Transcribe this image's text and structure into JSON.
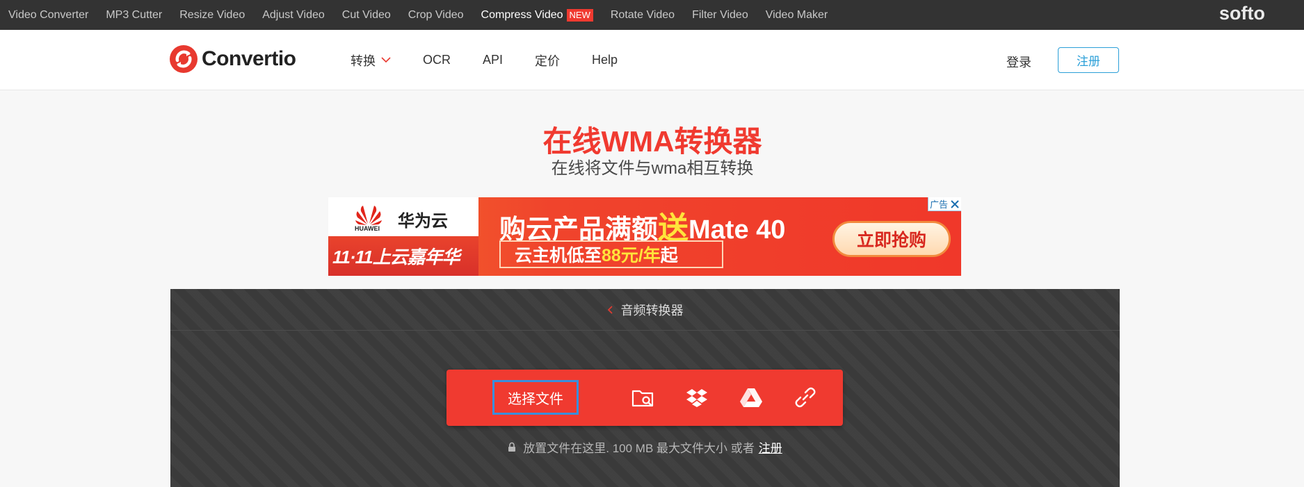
{
  "topbar": {
    "links": [
      "Video Converter",
      "MP3 Cutter",
      "Resize Video",
      "Adjust Video",
      "Cut Video",
      "Crop Video",
      "Compress Video",
      "Rotate Video",
      "Filter Video",
      "Video Maker"
    ],
    "new_badge": "NEW",
    "brand": "softo"
  },
  "header": {
    "logo_text": "Convertio",
    "nav": [
      "转换",
      "OCR",
      "API",
      "定价",
      "Help"
    ],
    "login": "登录",
    "register": "注册"
  },
  "hero": {
    "title": "在线WMA转换器",
    "subtitle": "在线将文件与wma相互转换"
  },
  "ad": {
    "brand_en": "HUAWEI",
    "brand_cn": "华为云",
    "promo_left": "11·11上云嘉年华",
    "headline_pre": "购云产品满额",
    "headline_song": "送",
    "headline_post": "Mate 40",
    "sub_pre": "云主机低至",
    "sub_hl": "88元/年",
    "sub_post": "起",
    "cta": "立即抢购",
    "tag": "广告"
  },
  "converter": {
    "breadcrumb": "音频转换器",
    "choose_files": "选择文件",
    "hint": "放置文件在这里. 100 MB 最大文件大小 或者",
    "hint_link": "注册"
  },
  "colors": {
    "accent_red": "#f03a30",
    "link_blue": "#2a9fd8",
    "topbar_bg": "#333333"
  },
  "icons": [
    "folder-search-icon",
    "dropbox-icon",
    "google-drive-icon",
    "link-icon",
    "lock-icon",
    "chevron-down-icon",
    "chevron-left-icon",
    "close-icon"
  ]
}
